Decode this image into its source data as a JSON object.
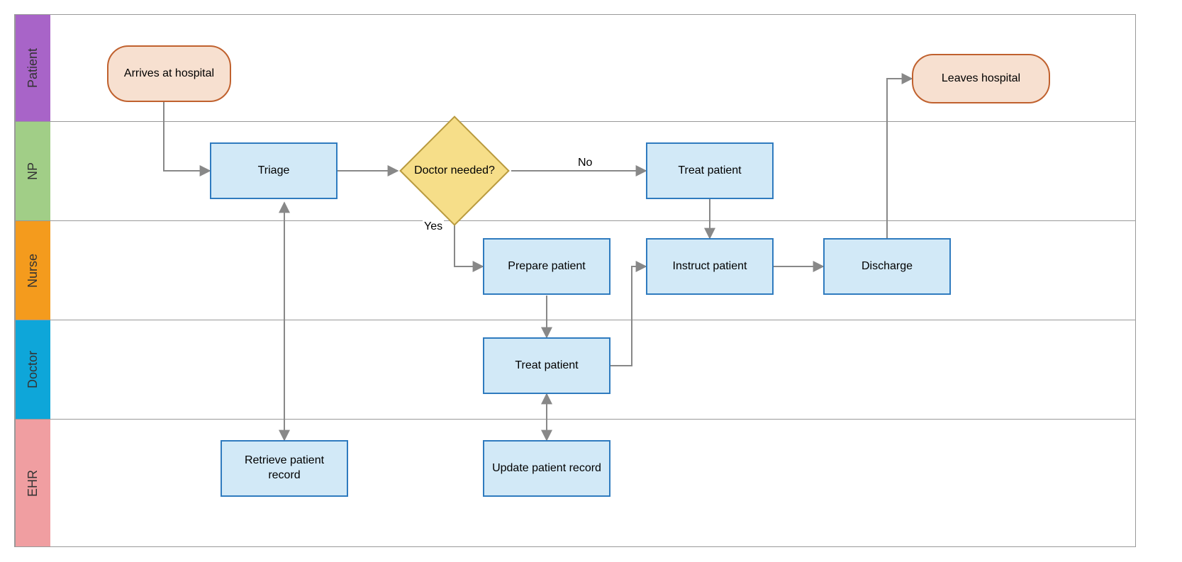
{
  "lanes": {
    "patient": "Patient",
    "np": "NP",
    "nurse": "Nurse",
    "doctor": "Doctor",
    "ehr": "EHR"
  },
  "nodes": {
    "arrives": "Arrives at hospital",
    "triage": "Triage",
    "doctor_needed": "Doctor needed?",
    "treat_np": "Treat patient",
    "leaves": "Leaves hospital",
    "prepare": "Prepare patient",
    "instruct": "Instruct patient",
    "discharge": "Discharge",
    "treat_doctor": "Treat patient",
    "retrieve": "Retrieve patient record",
    "update": "Update patient record"
  },
  "edge_labels": {
    "no": "No",
    "yes": "Yes"
  },
  "colors": {
    "patient_lane": "#a864c8",
    "np_lane": "#a1ce87",
    "nurse_lane": "#f49b1d",
    "doctor_lane": "#0ea6d9",
    "ehr_lane": "#f09ea1"
  },
  "chart_data": {
    "type": "swimlane-flowchart",
    "title": "",
    "lanes": [
      "Patient",
      "NP",
      "Nurse",
      "Doctor",
      "EHR"
    ],
    "nodes": [
      {
        "id": "arrives",
        "lane": "Patient",
        "shape": "terminator",
        "label": "Arrives at hospital"
      },
      {
        "id": "triage",
        "lane": "NP",
        "shape": "process",
        "label": "Triage"
      },
      {
        "id": "doctor_needed",
        "lane": "NP",
        "shape": "decision",
        "label": "Doctor needed?"
      },
      {
        "id": "treat_np",
        "lane": "NP",
        "shape": "process",
        "label": "Treat patient"
      },
      {
        "id": "leaves",
        "lane": "Patient",
        "shape": "terminator",
        "label": "Leaves hospital"
      },
      {
        "id": "prepare",
        "lane": "Nurse",
        "shape": "process",
        "label": "Prepare patient"
      },
      {
        "id": "instruct",
        "lane": "Nurse",
        "shape": "process",
        "label": "Instruct patient"
      },
      {
        "id": "discharge",
        "lane": "Nurse",
        "shape": "process",
        "label": "Discharge"
      },
      {
        "id": "treat_doctor",
        "lane": "Doctor",
        "shape": "process",
        "label": "Treat patient"
      },
      {
        "id": "retrieve",
        "lane": "EHR",
        "shape": "process",
        "label": "Retrieve patient record"
      },
      {
        "id": "update",
        "lane": "EHR",
        "shape": "process",
        "label": "Update patient record"
      }
    ],
    "edges": [
      {
        "from": "arrives",
        "to": "triage"
      },
      {
        "from": "triage",
        "to": "doctor_needed"
      },
      {
        "from": "doctor_needed",
        "to": "treat_np",
        "label": "No"
      },
      {
        "from": "doctor_needed",
        "to": "prepare",
        "label": "Yes"
      },
      {
        "from": "treat_np",
        "to": "instruct"
      },
      {
        "from": "prepare",
        "to": "treat_doctor"
      },
      {
        "from": "treat_doctor",
        "to": "instruct"
      },
      {
        "from": "instruct",
        "to": "discharge"
      },
      {
        "from": "discharge",
        "to": "leaves"
      },
      {
        "from": "retrieve",
        "to": "triage",
        "bidirectional": false
      },
      {
        "from": "triage",
        "to": "retrieve",
        "bidirectional": true
      },
      {
        "from": "treat_doctor",
        "to": "update",
        "bidirectional": true
      }
    ]
  }
}
